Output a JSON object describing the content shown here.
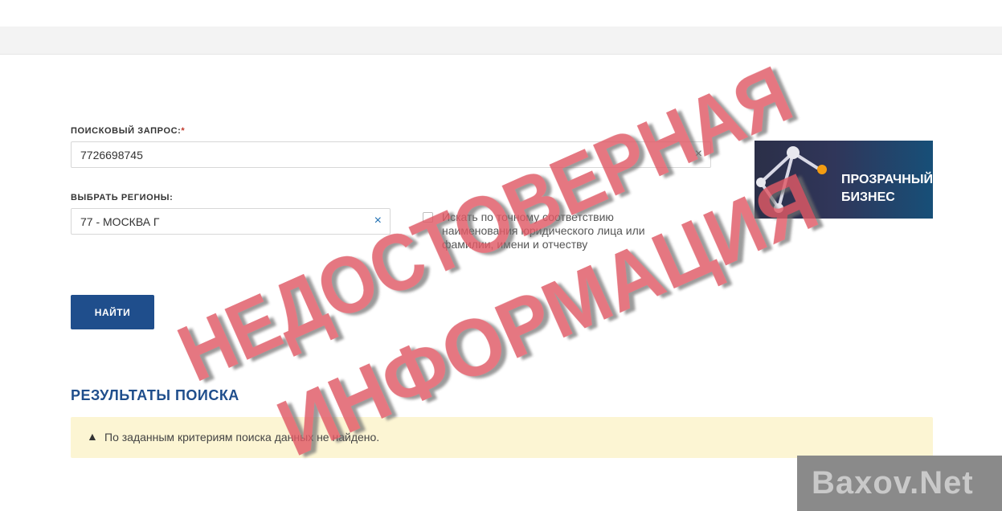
{
  "form": {
    "query_label": "ПОИСКОВЫЙ ЗАПРОС:",
    "required_mark": "*",
    "query_value": "7726698745",
    "region_label": "ВЫБРАТЬ РЕГИОНЫ:",
    "region_value": "77 - МОСКВА Г",
    "clear_symbol": "×",
    "exact_match_label": "Искать по точному соответствию наименования юридического лица или фамилии, имени и отчеству",
    "submit_label": "НАЙТИ"
  },
  "logo": {
    "line1": "ПРОЗРАЧНЫЙ",
    "line2": "БИЗНЕС"
  },
  "results": {
    "title": "РЕЗУЛЬТАТЫ ПОИСКА",
    "warning_symbol": "▲",
    "message": "По заданным критериям поиска данных не найдено."
  },
  "stamp": {
    "line1": "НЕДОСТОВЕРНАЯ",
    "line2": "ИНФОРМАЦИЯ",
    "color": "#e05a66"
  },
  "watermark": {
    "text": "Baxov.Net"
  },
  "colors": {
    "primary": "#1f4e8c",
    "alert_bg": "#fcf5d3",
    "clear_icon": "#1f6fb2"
  }
}
